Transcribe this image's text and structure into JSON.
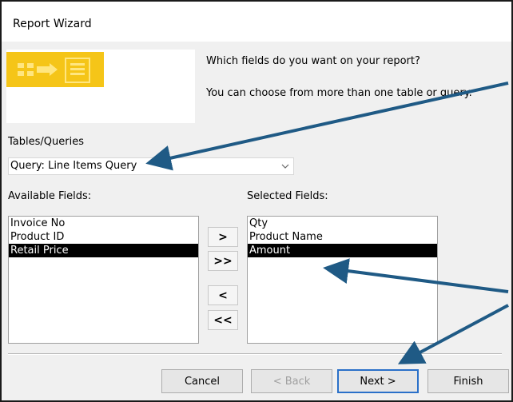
{
  "window": {
    "title": "Report Wizard"
  },
  "prompt": {
    "line1": "Which fields do you want on your report?",
    "line2": "You can choose from more than one table or query."
  },
  "tables_queries": {
    "label": "Tables/Queries",
    "selected": "Query: Line Items Query"
  },
  "available_fields": {
    "label": "Available Fields:",
    "items": [
      "Invoice No",
      "Product ID",
      "Retail Price"
    ],
    "selected": "Retail Price"
  },
  "selected_fields": {
    "label": "Selected Fields:",
    "items": [
      "Qty",
      "Product Name",
      "Amount"
    ],
    "selected": "Amount"
  },
  "move_buttons": {
    "add_one": ">",
    "add_all": ">>",
    "remove_one": "<",
    "remove_all": "<<"
  },
  "footer": {
    "cancel": "Cancel",
    "back": "< Back",
    "next": "Next >",
    "finish": "Finish"
  },
  "colors": {
    "selection": "#000000",
    "annotation_arrow": "#1f5a85",
    "wizard_icon": "#f5c518"
  },
  "icons": [
    "wizard-graphic-icon",
    "chevron-down-icon"
  ]
}
